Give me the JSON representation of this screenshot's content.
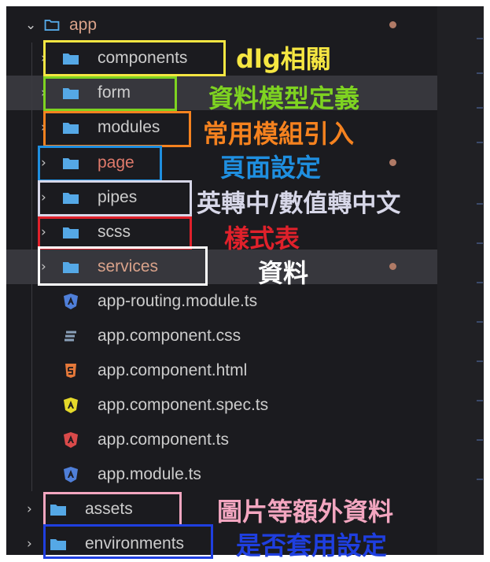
{
  "root": {
    "label": "app"
  },
  "folders": [
    {
      "label": "components"
    },
    {
      "label": "form"
    },
    {
      "label": "modules"
    },
    {
      "label": "page"
    },
    {
      "label": "pipes"
    },
    {
      "label": "scss"
    },
    {
      "label": "services"
    }
  ],
  "files": [
    {
      "label": "app-routing.module.ts",
      "icon": "angular-icon"
    },
    {
      "label": "app.component.css",
      "icon": "css-icon"
    },
    {
      "label": "app.component.html",
      "icon": "html-icon"
    },
    {
      "label": "app.component.spec.ts",
      "icon": "angular-test-icon"
    },
    {
      "label": "app.component.ts",
      "icon": "angular-component-icon"
    },
    {
      "label": "app.module.ts",
      "icon": "angular-icon"
    }
  ],
  "top_folders": [
    {
      "label": "assets"
    },
    {
      "label": "environments"
    }
  ],
  "annotations": [
    {
      "text": "dlg相關",
      "color": "#f5e642"
    },
    {
      "text": "資料模型定義",
      "color": "#7ed321"
    },
    {
      "text": "常用模組引入",
      "color": "#f5821f"
    },
    {
      "text": "頁面設定",
      "color": "#1f8fe0"
    },
    {
      "text": "英轉中/數值轉中文",
      "color": "#d7d7e8"
    },
    {
      "text": "樣式表",
      "color": "#e0212b"
    },
    {
      "text": "資料",
      "color": "#ffffff"
    },
    {
      "text": "圖片等額外資料",
      "color": "#f3a6c0"
    },
    {
      "text": "是否套用設定",
      "color": "#1f3fe0"
    }
  ],
  "colors": {
    "folder_blue": "#55a8e6",
    "background": "#1b1b1f",
    "text": "#cccccc",
    "page_label": "#e07a6b",
    "scss_label": "#e07a6b"
  }
}
